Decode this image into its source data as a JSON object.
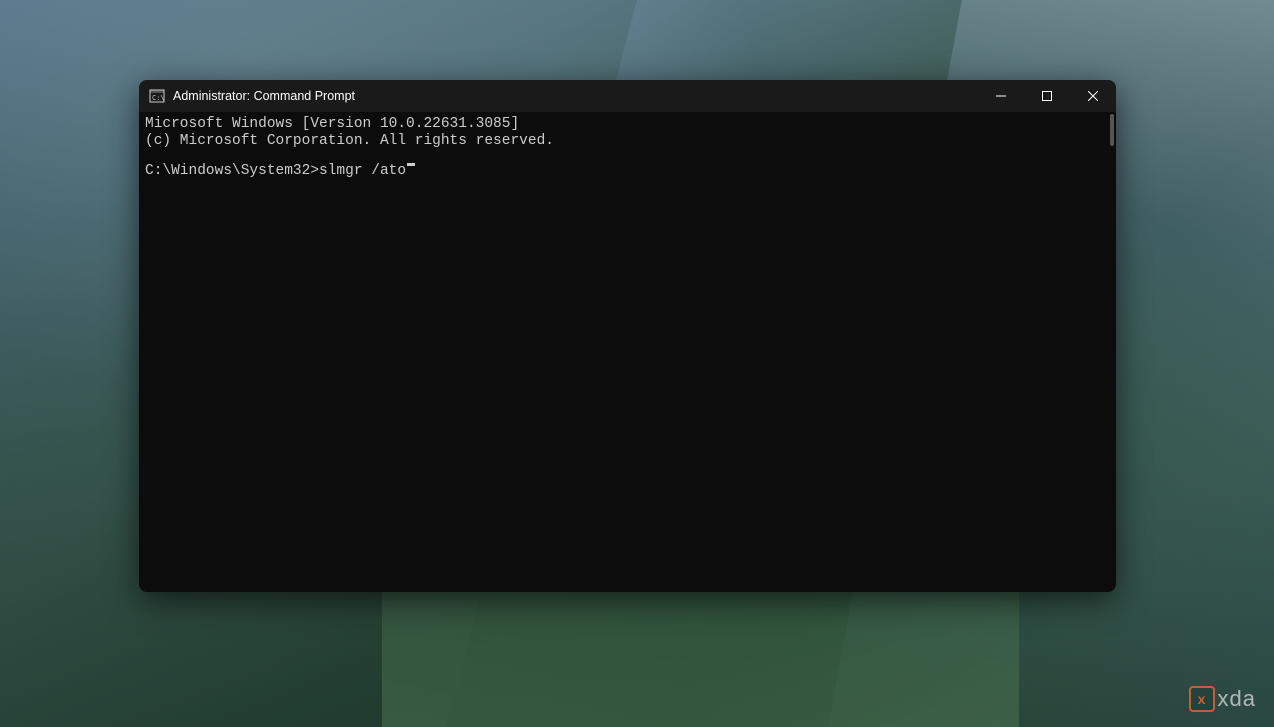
{
  "window": {
    "title": "Administrator: Command Prompt"
  },
  "terminal": {
    "line1": "Microsoft Windows [Version 10.0.22631.3085]",
    "line2": "(c) Microsoft Corporation. All rights reserved.",
    "prompt": "C:\\Windows\\System32>",
    "command": "slmgr /ato"
  },
  "watermark": {
    "icon_text": "x",
    "text": "xda"
  }
}
